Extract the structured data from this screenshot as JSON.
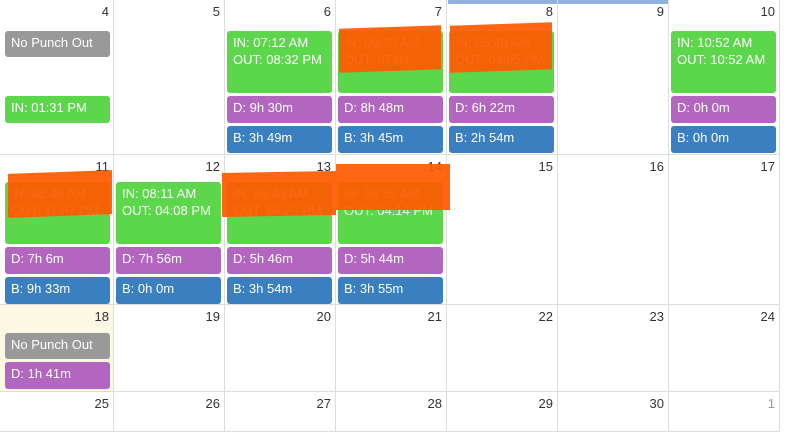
{
  "week1": {
    "days": [
      "4",
      "5",
      "6",
      "7",
      "8",
      "9",
      "10"
    ],
    "d4": {
      "status": "No Punch Out",
      "in": "IN: 01:31 PM"
    },
    "d6": {
      "punch": "IN: 07:12 AM OUT: 08:32 PM",
      "d": "D: 9h 30m",
      "b": "B: 3h 49m"
    },
    "d7": {
      "punch": "IN: 06:30 AM OUT: 07:04",
      "d": "D: 8h 48m",
      "b": "B: 3h 45m"
    },
    "d8": {
      "punch": "IN: 06:48 AM OUT: 04:05 PM",
      "d": "D: 6h 22m",
      "b": "B: 2h 54m"
    },
    "d10": {
      "punch": "IN: 10:52 AM OUT: 10:52 AM",
      "d": "D: 0h 0m",
      "b": "B: 0h 0m"
    }
  },
  "week2": {
    "days": [
      "11",
      "12",
      "13",
      "14",
      "15",
      "16",
      "17"
    ],
    "d11": {
      "punch": "IN: 06:46 AM OUT: 11:27 PM",
      "d": "D: 7h 6m",
      "b": "B: 9h 33m"
    },
    "d12": {
      "punch": "IN: 08:11 AM OUT: 04:08 PM",
      "d": "D: 7h 56m",
      "b": "B: 0h 0m"
    },
    "d13": {
      "punch": "IN: 06:40 AM OUT: 04:20 PM",
      "d": "D: 5h 46m",
      "b": "B: 3h 54m"
    },
    "d14": {
      "punch": "IN: 06:35 AM OUT: 04:14 PM",
      "d": "D: 5h 44m",
      "b": "B: 3h 55m"
    }
  },
  "week3": {
    "days": [
      "18",
      "19",
      "20",
      "21",
      "22",
      "23",
      "24"
    ],
    "d18": {
      "status": "No Punch Out",
      "d": "D: 1h 41m"
    }
  },
  "week4": {
    "days": [
      "25",
      "26",
      "27",
      "28",
      "29",
      "30",
      "1"
    ]
  },
  "colors": {
    "gray": "#999999",
    "green": "#5cd64a",
    "purple": "#b266c0",
    "blue": "#3a7fbf",
    "redaction": "#ff5a00",
    "today": "#fcf8e3"
  }
}
